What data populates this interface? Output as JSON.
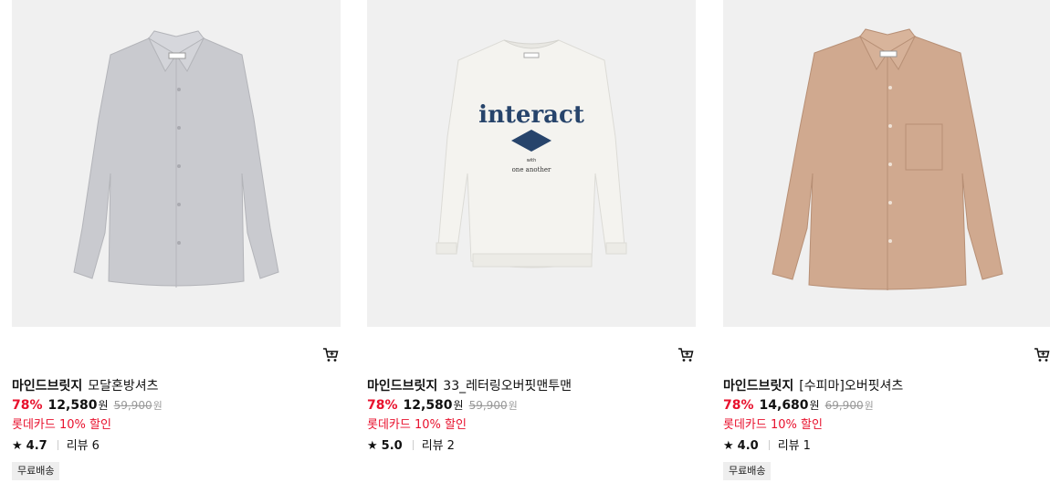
{
  "products": [
    {
      "brand": "마인드브릿지",
      "title": "모달혼방셔츠",
      "discount_rate": "78%",
      "sale_price": "12,580",
      "currency": "원",
      "original_price": "59,900",
      "card_discount": "롯데카드 10% 할인",
      "rating": "4.7",
      "review_label": "리뷰",
      "review_count": "6",
      "badge": "무료배송",
      "image_color": "#c9cacf"
    },
    {
      "brand": "마인드브릿지",
      "title": "33_레터링오버핏맨투맨",
      "discount_rate": "78%",
      "sale_price": "12,580",
      "currency": "원",
      "original_price": "59,900",
      "card_discount": "롯데카드 10% 할인",
      "rating": "5.0",
      "review_label": "리뷰",
      "review_count": "2",
      "graphic_text": "interact",
      "graphic_small": "with",
      "graphic_sub": "one another",
      "image_color": "#f4f3ef"
    },
    {
      "brand": "마인드브릿지",
      "title": "[수피마]오버핏셔츠",
      "discount_rate": "78%",
      "sale_price": "14,680",
      "currency": "원",
      "original_price": "69,900",
      "card_discount": "롯데카드 10% 할인",
      "rating": "4.0",
      "review_label": "리뷰",
      "review_count": "1",
      "badge": "무료배송",
      "image_color": "#d0a98f"
    }
  ],
  "icons": {
    "cart": "cart-icon",
    "star": "star-icon"
  },
  "colors": {
    "discount": "#e8112d",
    "muted": "#999999",
    "badge_bg": "#eeeeee"
  }
}
